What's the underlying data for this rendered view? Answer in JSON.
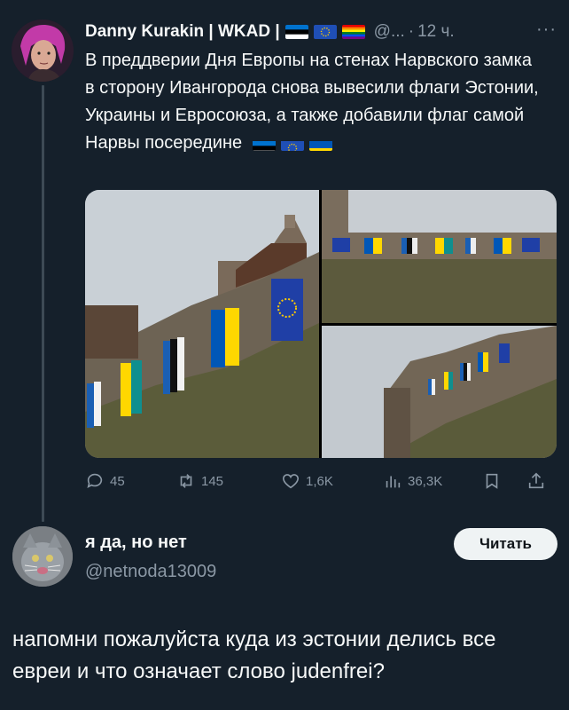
{
  "post": {
    "author_name": "Danny Kurakin | WKAD |",
    "handle": "@...",
    "time": "12 ч.",
    "more_label": "···",
    "text": "В преддверии Дня Европы на стенах Нарвского замка в сторону Ивангорода снова вывесили флаги Эстонии, Украины и Евросоюза, а также добавили флаг самой Нарвы посередине",
    "name_flags": [
      "estonia-flag",
      "eu-flag",
      "rainbow-flag"
    ],
    "text_flags": [
      "estonia-flag",
      "eu-flag",
      "ukraine-flag"
    ],
    "actions": {
      "replies": "45",
      "reposts": "145",
      "likes": "1,6K",
      "views": "36,3K"
    }
  },
  "reply": {
    "author_name": "я да, но нет",
    "handle": "@netnoda13009",
    "follow_label": "Читать",
    "text": "напомни пожалуйста куда из эстонии делись все евреи и что означает слово judenfrei?"
  },
  "colors": {
    "background": "#15202b",
    "text_primary": "#f7f9f9",
    "text_secondary": "#8b98a5",
    "button_bg": "#eff3f4"
  }
}
